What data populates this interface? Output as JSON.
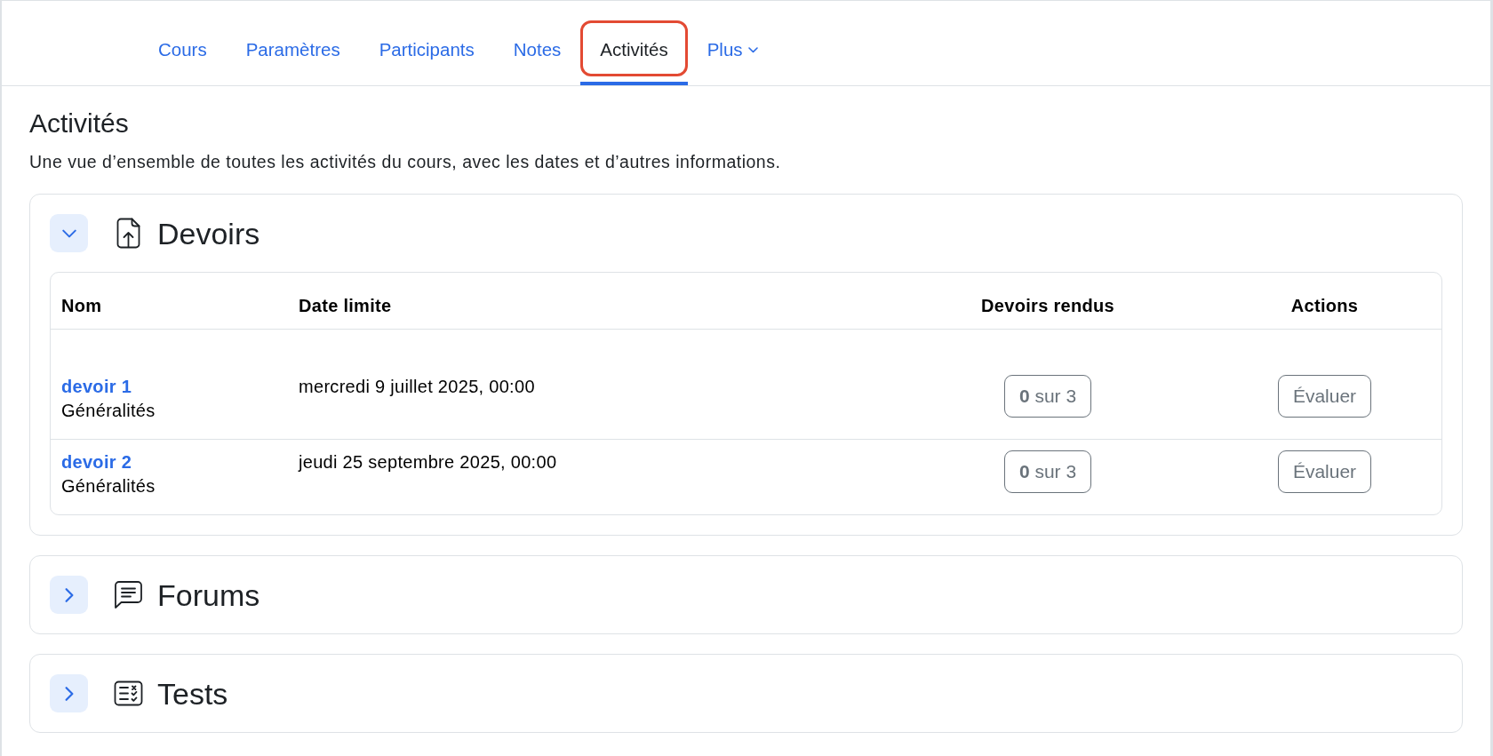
{
  "tabs": [
    {
      "label": "Cours",
      "kind": "link",
      "selected": false,
      "highlighted": false
    },
    {
      "label": "Paramètres",
      "kind": "link",
      "selected": false,
      "highlighted": false
    },
    {
      "label": "Participants",
      "kind": "link",
      "selected": false,
      "highlighted": false
    },
    {
      "label": "Notes",
      "kind": "link",
      "selected": false,
      "highlighted": false
    },
    {
      "label": "Activités",
      "kind": "link",
      "selected": true,
      "highlighted": true
    },
    {
      "label": "Plus",
      "kind": "dropdown",
      "selected": false,
      "highlighted": false
    }
  ],
  "page": {
    "title": "Activités",
    "description": "Une vue d’ensemble de toutes les activités du cours, avec les dates et d’autres informations."
  },
  "sections": [
    {
      "kind": "assignment",
      "title": "Devoirs",
      "expanded": true,
      "table": {
        "columns": [
          "Nom",
          "Date limite",
          "Devoirs rendus",
          "Actions"
        ],
        "rows": [
          {
            "name": "devoir 1",
            "section": "Généralités",
            "due_date": "mercredi 9 juillet 2025, 00:00",
            "submissions": "**0** sur 3",
            "action": "Évaluer"
          },
          {
            "name": "devoir 2",
            "section": "Généralités",
            "due_date": "jeudi 25 septembre 2025, 00:00",
            "submissions": "**0** sur 3",
            "action": "Évaluer"
          }
        ]
      }
    },
    {
      "kind": "forum",
      "title": "Forums",
      "expanded": false
    },
    {
      "kind": "quiz",
      "title": "Tests",
      "expanded": false
    }
  ]
}
